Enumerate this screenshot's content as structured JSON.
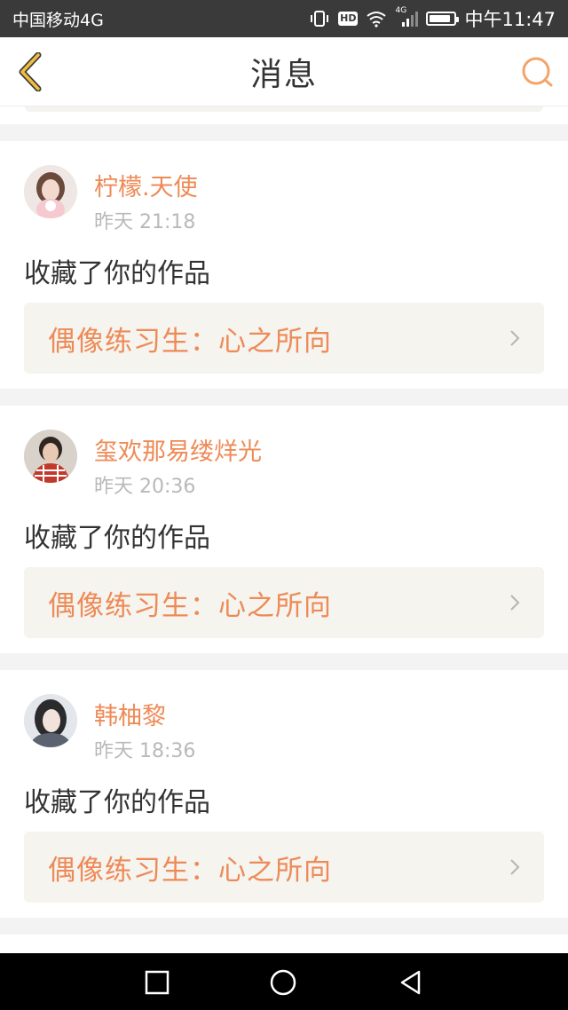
{
  "status_bar": {
    "carrier": "中国移动4G",
    "network_label": "4G",
    "hd_label": "HD",
    "time": "中午11:47",
    "battery_level": 0.85
  },
  "nav": {
    "title": "消息"
  },
  "messages": [
    {
      "user": "柠檬.天使",
      "time": "昨天 21:18",
      "action": "收藏了你的作品",
      "work": "偶像练习生：心之所向"
    },
    {
      "user": "玺欢那易缕烊光",
      "time": "昨天 20:36",
      "action": "收藏了你的作品",
      "work": "偶像练习生：心之所向"
    },
    {
      "user": "韩柚黎",
      "time": "昨天 18:36",
      "action": "收藏了你的作品",
      "work": "偶像练习生：心之所向"
    }
  ],
  "colors": {
    "accent": "#ee8a57",
    "back_icon": "#f2bd3c",
    "search_icon": "#f3a569",
    "card_link_bg": "#f5f4ef"
  },
  "icons": {
    "back": "back-chevron-icon",
    "search": "search-icon",
    "chevron": "chevron-right-icon",
    "recent_apps": "square-icon",
    "home": "circle-icon",
    "back_nav": "triangle-back-icon"
  }
}
